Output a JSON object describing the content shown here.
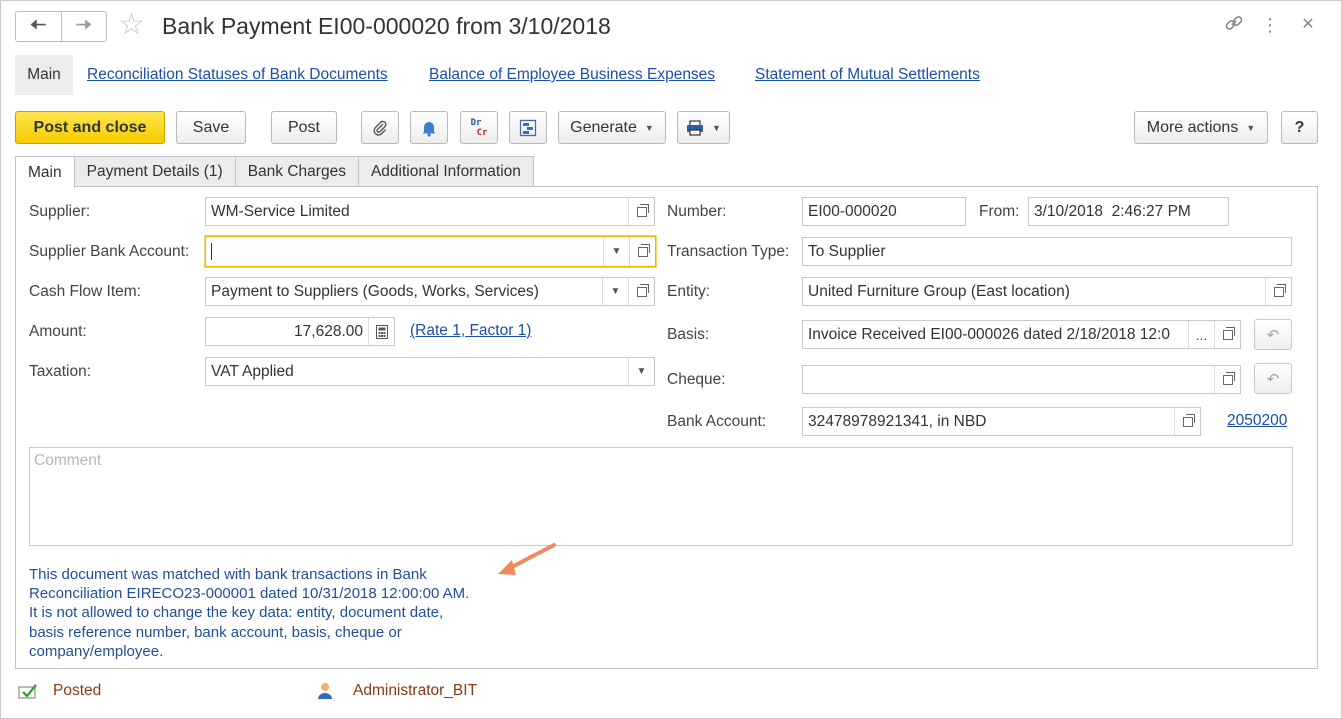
{
  "header": {
    "back_icon": "arrow-left-icon",
    "forward_icon": "arrow-right-icon",
    "title": "Bank Payment EI00-000020 from 3/10/2018",
    "link_icon": "chain-link-icon",
    "more_icon": "vertical-dots-icon",
    "close_icon": "close-icon"
  },
  "sections": {
    "main": "Main",
    "links": [
      "Reconciliation Statuses of Bank Documents",
      "Balance of Employee Business Expenses",
      "Statement of Mutual Settlements"
    ]
  },
  "toolbar": {
    "post_and_close": "Post and close",
    "save": "Save",
    "post": "Post",
    "drcr_top": "Dr",
    "drcr_bottom": "Cr",
    "generate": "Generate",
    "more_actions": "More actions",
    "help": "?"
  },
  "tabs": [
    "Main",
    "Payment Details (1)",
    "Bank Charges",
    "Additional Information"
  ],
  "form": {
    "supplier": {
      "label": "Supplier:",
      "value": "WM-Service Limited"
    },
    "supplier_bank_account": {
      "label": "Supplier Bank Account:",
      "value": ""
    },
    "cash_flow_item": {
      "label": "Cash Flow Item:",
      "value": "Payment to Suppliers (Goods, Works, Services)"
    },
    "amount": {
      "label": "Amount:",
      "value": "17,628.00",
      "rate_link": "(Rate 1, Factor 1)"
    },
    "taxation": {
      "label": "Taxation:",
      "value": "VAT Applied"
    },
    "number": {
      "label": "Number:",
      "value": "EI00-000020"
    },
    "from": {
      "label": "From:",
      "value": "3/10/2018  2:46:27 PM"
    },
    "transaction_type": {
      "label": "Transaction Type:",
      "value": "To Supplier"
    },
    "entity": {
      "label": "Entity:",
      "value": "United Furniture Group (East location)"
    },
    "basis": {
      "label": "Basis:",
      "value": "Invoice Received EI00-000026 dated 2/18/2018 12:0",
      "more": "..."
    },
    "cheque": {
      "label": "Cheque:",
      "value": ""
    },
    "bank_account": {
      "label": "Bank Account:",
      "value": "32478978921341, in NBD",
      "code_link": "2050200"
    },
    "comment_placeholder": "Comment"
  },
  "info_message": [
    "This document was matched with bank transactions in Bank",
    "Reconciliation EIRECO23-000001 dated 10/31/2018 12:00:00 AM.",
    "It is not allowed to change the key data: entity, document date,",
    "basis reference number, bank account, basis, cheque or",
    "company/employee."
  ],
  "status_bar": {
    "posted": "Posted",
    "user": "Administrator_BIT"
  },
  "colors": {
    "accent_yellow": "#f5cd00",
    "link_blue": "#1a4fb0",
    "info_blue": "#1f4f9a",
    "status_brown": "#8a3a10",
    "arrow_orange": "#f08a5d"
  }
}
